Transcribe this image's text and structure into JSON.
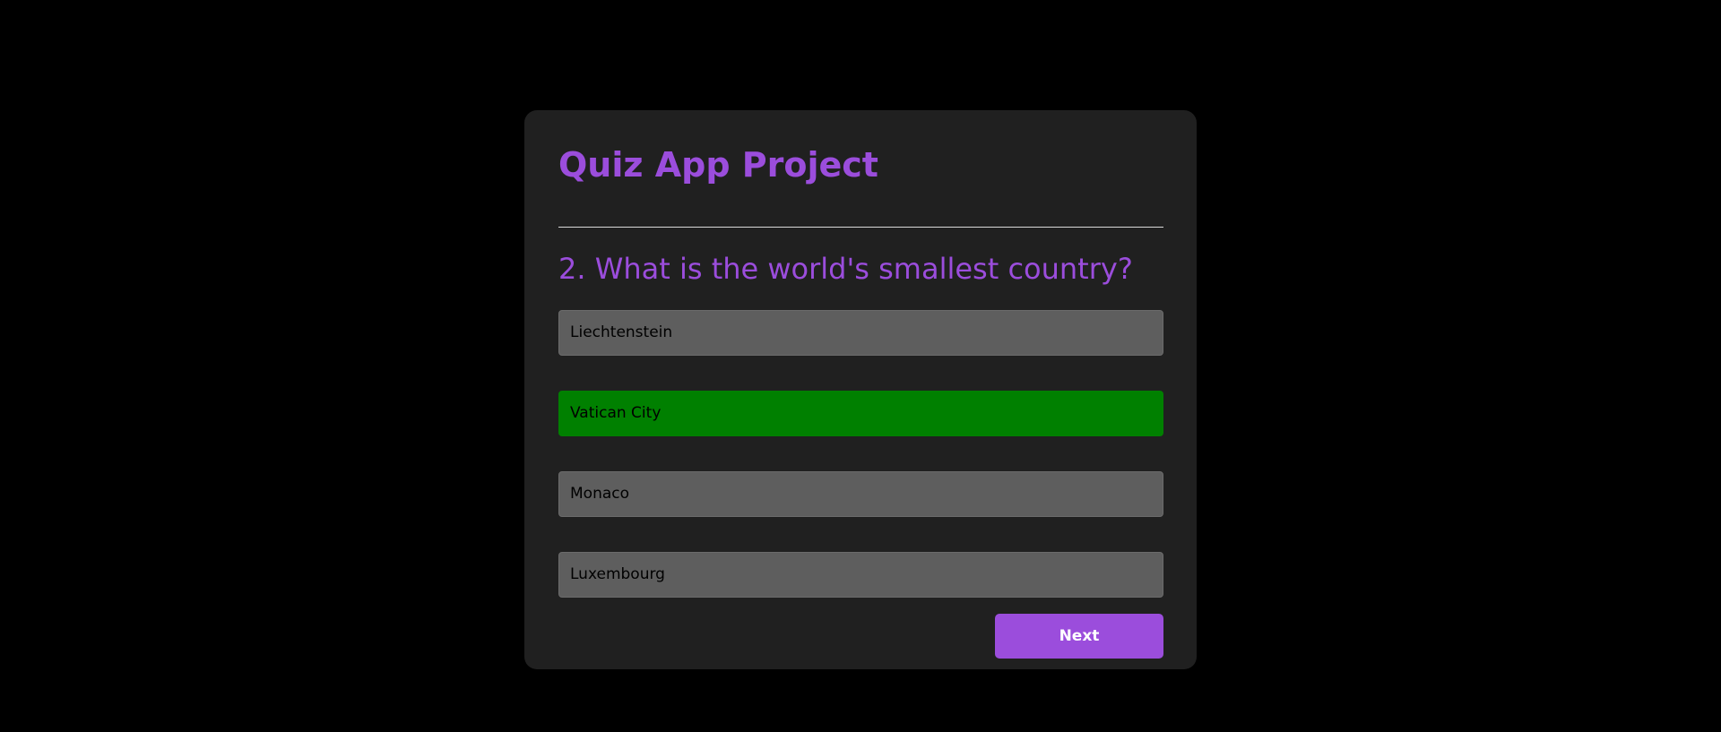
{
  "app": {
    "title": "Quiz App Project"
  },
  "quiz": {
    "question": "2. What is the world's smallest country?",
    "answers": [
      {
        "label": "Liechtenstein",
        "state": "default"
      },
      {
        "label": "Vatican City",
        "state": "correct"
      },
      {
        "label": "Monaco",
        "state": "default"
      },
      {
        "label": "Luxembourg",
        "state": "default"
      }
    ],
    "next_label": "Next"
  },
  "colors": {
    "background": "#000000",
    "card": "#202020",
    "accent": "#9b4ddc",
    "answer_default": "#5e5e5e",
    "answer_correct": "#008000"
  }
}
